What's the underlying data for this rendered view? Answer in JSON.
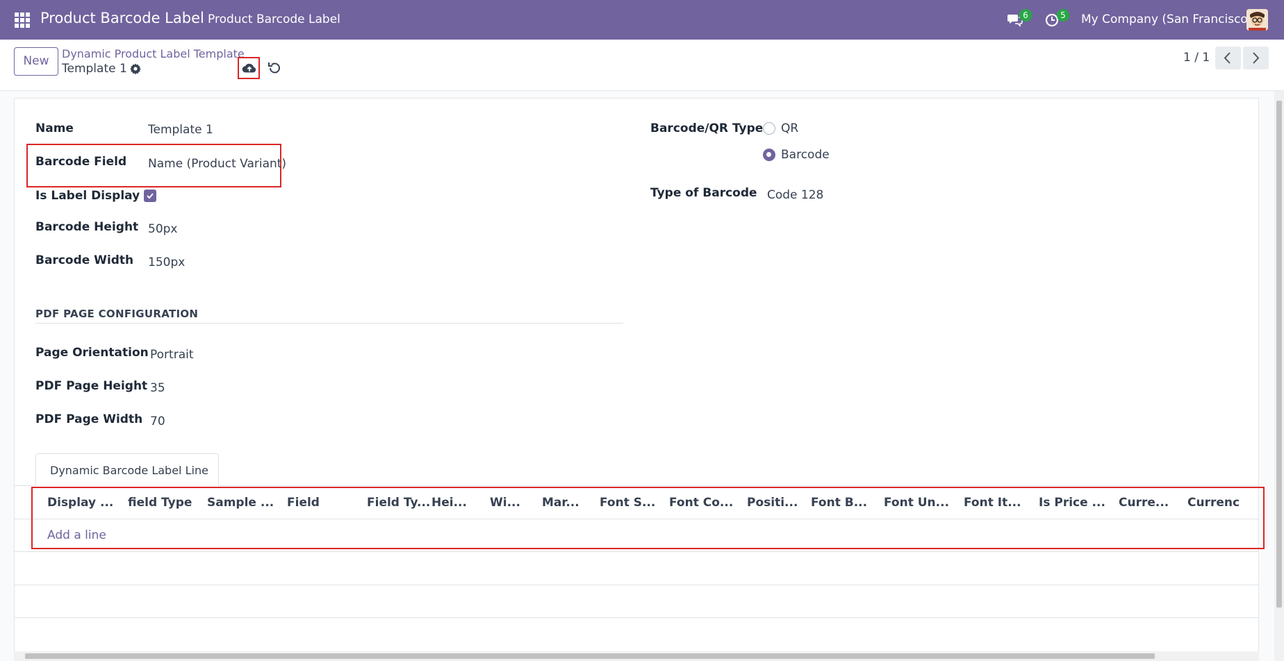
{
  "navbar": {
    "app_title": "Product Barcode Label",
    "menu_item": "Product Barcode Label",
    "messages_count": "6",
    "activities_count": "5",
    "company": "My Company (San Francisco)"
  },
  "control_panel": {
    "new_label": "New",
    "breadcrumb_parent": "Dynamic Product Label Template",
    "breadcrumb_current": "Template 1",
    "pager": "1 / 1"
  },
  "form": {
    "name_label": "Name",
    "name_value": "Template 1",
    "barcode_field_label": "Barcode Field",
    "barcode_field_value": "Name (Product Variant)",
    "label_display_label": "Is Label Display ?",
    "label_display_checked": true,
    "barcode_height_label": "Barcode Height",
    "barcode_height_value": "50px",
    "barcode_width_label": "Barcode Width",
    "barcode_width_value": "150px",
    "qr_type_label": "Barcode/QR Type",
    "qr_type_options": [
      "QR",
      "Barcode"
    ],
    "qr_type_selected": "Barcode",
    "type_of_barcode_label": "Type of Barcode",
    "type_of_barcode_value": "Code 128",
    "pdf_section_title": "PDF PAGE CONFIGURATION",
    "page_orientation_label": "Page Orientation",
    "page_orientation_value": "Portrait",
    "pdf_height_label": "PDF Page Height",
    "pdf_height_value": "35",
    "pdf_width_label": "PDF Page Width",
    "pdf_width_value": "70"
  },
  "notebook": {
    "tab_label": "Dynamic Barcode Label Line",
    "columns": [
      "Display ...",
      "field Type",
      "Sample ...",
      "Field",
      "Field Ty...",
      "Hei...",
      "Wi...",
      "Mar...",
      "Font S...",
      "Font Co...",
      "Positi...",
      "Font B...",
      "Font Un...",
      "Font It...",
      "Is Price ...",
      "Curre...",
      "Currenc"
    ],
    "add_line": "Add a line"
  },
  "colors": {
    "brand": "#71639e",
    "highlight": "#dc2626",
    "badge": "#28a745"
  }
}
